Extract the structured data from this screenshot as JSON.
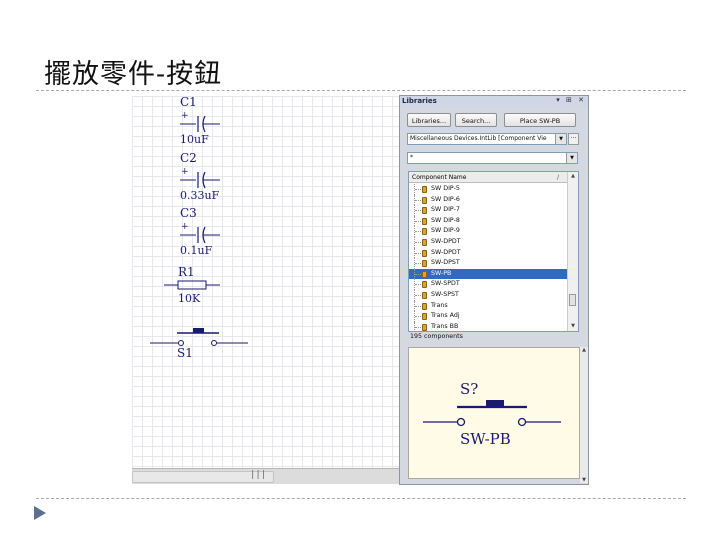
{
  "slide": {
    "title": "擺放零件-按鈕"
  },
  "schematic": {
    "capacitors": [
      {
        "ref": "C1",
        "value": "10uF",
        "polarity": "+"
      },
      {
        "ref": "C2",
        "value": "0.33uF",
        "polarity": "+"
      },
      {
        "ref": "C3",
        "value": "0.1uF",
        "polarity": "+"
      }
    ],
    "resistor": {
      "ref": "R1",
      "value": "10K"
    },
    "switch": {
      "ref": "S1"
    },
    "scrollbar_grip": "|||"
  },
  "libraries_panel": {
    "title": "Libraries",
    "controls": "▾ ⊞ ✕",
    "buttons": {
      "libraries": "Libraries...",
      "search": "Search...",
      "place": "Place SW-PB"
    },
    "library_select": {
      "value": "Miscellaneous Devices.IntLib [Component Vie",
      "more": "···"
    },
    "filter": {
      "value": "*"
    },
    "list": {
      "column_header": "Component Name",
      "sort_indicator": "/",
      "items": [
        "SW DIP-5",
        "SW DIP-6",
        "SW DIP-7",
        "SW DIP-8",
        "SW DIP-9",
        "SW-DPDT",
        "SW-DPDT",
        "SW-DPST",
        "SW-PB",
        "SW-SPDT",
        "SW-SPST",
        "Trans",
        "Trans Adj",
        "Trans BB"
      ],
      "selected_item": "SW-PB",
      "count": "195 components"
    },
    "preview": {
      "ref": "S?",
      "name": "SW-PB"
    }
  },
  "colors": {
    "wire": "#1a1a6e",
    "selection": "#316ac5",
    "preview_bg": "#fffbe6",
    "component_icon": "#d8a531"
  }
}
